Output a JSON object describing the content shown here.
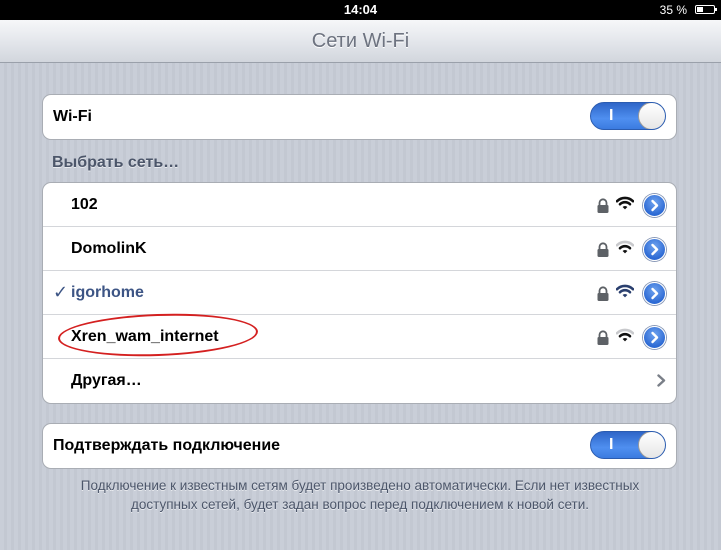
{
  "status_bar": {
    "time": "14:04",
    "battery_percent_text": "35 %",
    "battery_level": 0.35
  },
  "nav": {
    "title": "Сети Wi-Fi"
  },
  "wifi_toggle": {
    "label": "Wi-Fi",
    "state_label": "I",
    "on": true
  },
  "network_section": {
    "header": "Выбрать сеть…",
    "networks": [
      {
        "name": "102",
        "secured": true,
        "signal": 3,
        "selected": false
      },
      {
        "name": "DomolinK",
        "secured": true,
        "signal": 2,
        "selected": false
      },
      {
        "name": "igorhome",
        "secured": true,
        "signal": 3,
        "selected": true
      },
      {
        "name": "Xren_wam_internet",
        "secured": true,
        "signal": 2,
        "selected": false
      }
    ],
    "other_label": "Другая…",
    "checkmark": "✓"
  },
  "ask_join": {
    "label": "Подтверждать подключение",
    "state_label": "I",
    "on": true
  },
  "footer": {
    "note": "Подключение к известным сетям будет произведено автоматически. Если нет известных доступных сетей, будет задан вопрос перед подключением к новой сети."
  },
  "icons": {
    "lock": "lock-icon",
    "wifi": "wifi-signal-icon",
    "detail": "detail-disclosure-icon",
    "chevron": "chevron-right-icon"
  },
  "colors": {
    "toggle_on": "#4f8ff0",
    "selected_text": "#3d5585",
    "highlight_circle": "#d42020",
    "detail_button": "#2d6ad4"
  }
}
